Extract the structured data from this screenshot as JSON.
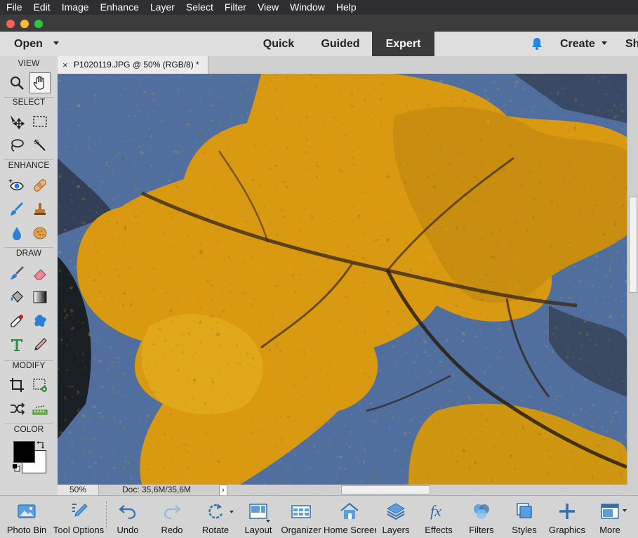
{
  "menu": [
    "File",
    "Edit",
    "Image",
    "Enhance",
    "Layer",
    "Select",
    "Filter",
    "View",
    "Window",
    "Help"
  ],
  "header": {
    "open_label": "Open",
    "modes": [
      "Quick",
      "Guided",
      "Expert"
    ],
    "active_mode": "Expert",
    "create_label": "Create",
    "share_label": "Sh"
  },
  "toolbox": {
    "sections": [
      "VIEW",
      "SELECT",
      "ENHANCE",
      "DRAW",
      "MODIFY",
      "COLOR"
    ]
  },
  "document": {
    "tab_title": "P1020119.JPG @ 50% (RGB/8) *",
    "close_glyph": "×",
    "zoom": "50%",
    "doc_info": "Doc: 35,6M/35,6M",
    "more_glyph": "›"
  },
  "bottom": [
    "Photo Bin",
    "Tool Options",
    "Undo",
    "Redo",
    "Rotate",
    "Layout",
    "Organizer",
    "Home Screen",
    "Layers",
    "Effects",
    "Filters",
    "Styles",
    "Graphics",
    "More"
  ],
  "colors": {
    "accent": "#1e88e5",
    "foreground": "#000000",
    "background": "#ffffff"
  }
}
